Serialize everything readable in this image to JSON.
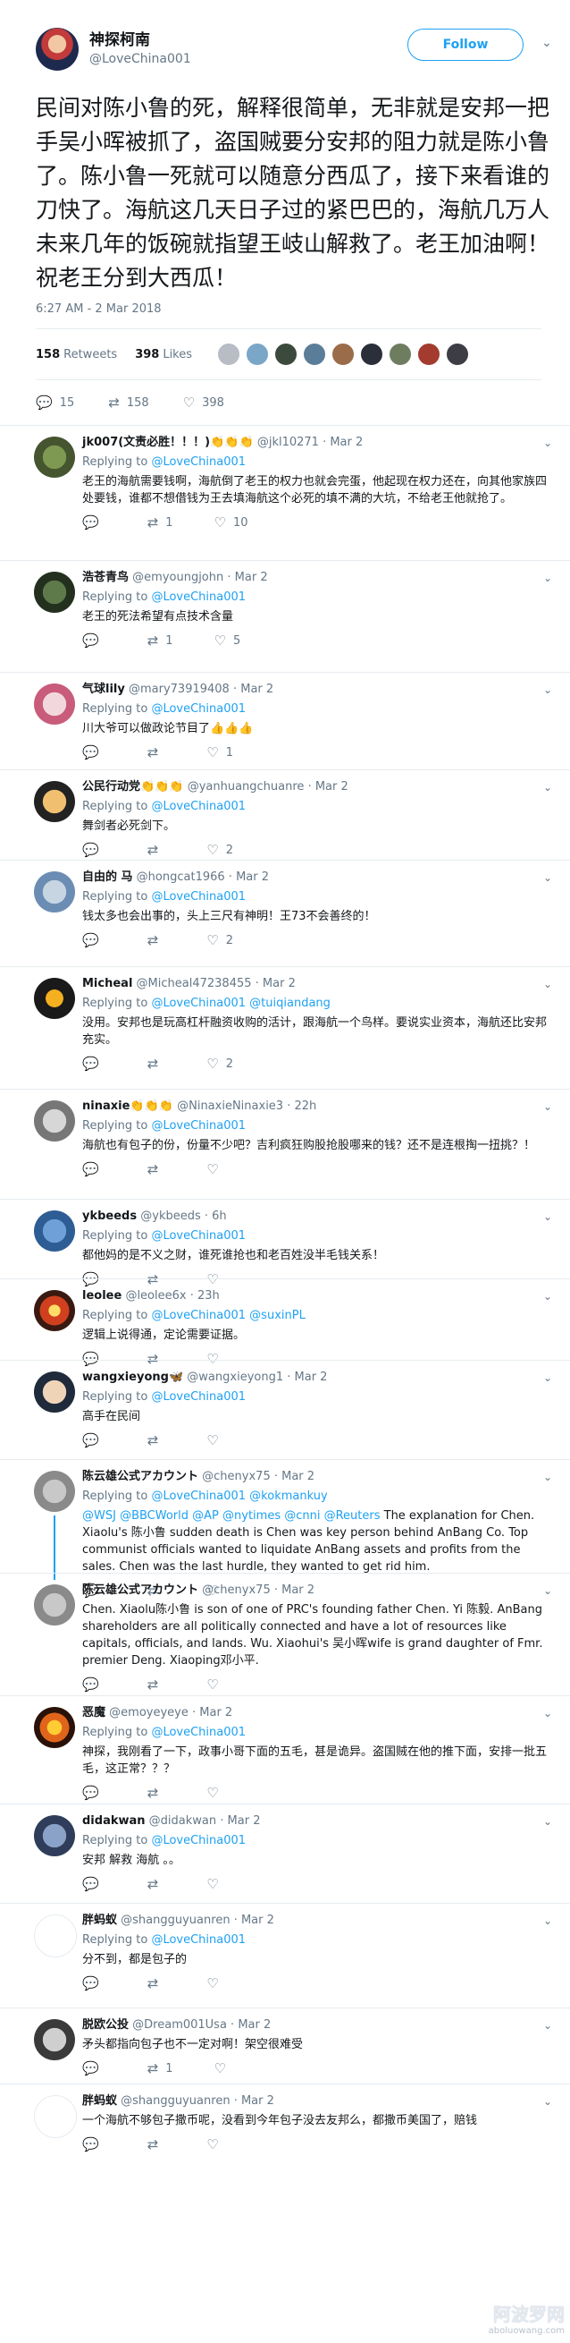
{
  "main_tweet": {
    "name": "神探柯南",
    "handle": "@LoveChina001",
    "follow_label": "Follow",
    "text": "民间对陈小鲁的死，解释很简单，无非就是安邦一把手吴小晖被抓了，盗国贼要分安邦的阻力就是陈小鲁了。陈小鲁一死就可以随意分西瓜了，接下来看谁的刀快了。海航这几天日子过的紧巴巴的，海航几万人未来几年的饭碗就指望王岐山解救了。老王加油啊！祝老王分到大西瓜！",
    "timestamp": "6:27 AM - 2 Mar 2018",
    "retweets_count": "158",
    "retweets_label": "Retweets",
    "likes_count": "398",
    "likes_label": "Likes",
    "reply_count": "15",
    "retweet_count": "158",
    "like_count": "398"
  },
  "replies": [
    {
      "name": "jk007(文责必胜！！！)👏👏👏",
      "handle": "@jkl10271",
      "time": "Mar 2",
      "replying_to": "Replying to",
      "to": "@LoveChina001",
      "text": "老王的海航需要钱啊，海航倒了老王的权力也就会完蛋，他起现在权力还在，向其他家族四处要钱，谁都不想借钱为王去填海航这个必死的填不满的大坑，不给老王他就抢了。",
      "actions": {
        "reply": "",
        "retweet": "1",
        "like": "10"
      }
    },
    {
      "name": "浩苍青鸟",
      "handle": "@emyoungjohn",
      "time": "Mar 2",
      "replying_to": "Replying to",
      "to": "@LoveChina001",
      "text": "老王的死法希望有点技术含量",
      "actions": {
        "reply": "",
        "retweet": "1",
        "like": "5"
      }
    },
    {
      "name": "气球lily",
      "handle": "@mary73919408",
      "time": "Mar 2",
      "replying_to": "Replying to",
      "to": "@LoveChina001",
      "text": "川大爷可以做政论节目了👍👍👍",
      "actions": {
        "reply": "",
        "retweet": "",
        "like": "1"
      }
    },
    {
      "name": "公民行动党👏👏👏",
      "handle": "@yanhuangchuanre",
      "time": "Mar 2",
      "replying_to": "Replying to",
      "to": "@LoveChina001",
      "text": "舞剑者必死剑下。",
      "actions": {
        "reply": "",
        "retweet": "",
        "like": "2"
      }
    },
    {
      "name": "自由的 马",
      "handle": "@hongcat1966",
      "time": "Mar 2",
      "replying_to": "Replying to",
      "to": "@LoveChina001",
      "text": "钱太多也会出事的，头上三尺有神明！王73不会善终的！",
      "actions": {
        "reply": "",
        "retweet": "",
        "like": "2"
      }
    },
    {
      "name": "Micheal",
      "handle": "@Micheal47238455",
      "time": "Mar 2",
      "replying_to": "Replying to",
      "to": "@LoveChina001 @tuiqiandang",
      "text": "没用。安邦也是玩高杠杆融资收购的活计，跟海航一个鸟样。要说实业资本，海航还比安邦充实。",
      "actions": {
        "reply": "",
        "retweet": "",
        "like": "2"
      }
    },
    {
      "name": "ninaxie👏👏👏",
      "handle": "@NinaxieNinaxie3",
      "time": "22h",
      "replying_to": "Replying to",
      "to": "@LoveChina001",
      "text": "海航也有包子的份，份量不少吧？吉利疯狂购股抢股哪来的钱？还不是连根掏一扭挑？！",
      "actions": {
        "reply": "",
        "retweet": "",
        "like": ""
      }
    },
    {
      "name": "ykbeeds",
      "handle": "@ykbeeds",
      "time": "6h",
      "replying_to": "Replying to",
      "to": "@LoveChina001",
      "text": "都他妈的是不义之财，谁死谁抢也和老百姓没半毛钱关系！",
      "actions": {
        "reply": "",
        "retweet": "",
        "like": ""
      }
    },
    {
      "name": "leolee",
      "handle": "@leolee6x",
      "time": "23h",
      "replying_to": "Replying to",
      "to": "@LoveChina001 @suxinPL",
      "text": "逻辑上说得通，定论需要证据。",
      "actions": {
        "reply": "",
        "retweet": "",
        "like": ""
      }
    },
    {
      "name": "wangxieyong🦋",
      "handle": "@wangxieyong1",
      "time": "Mar 2",
      "replying_to": "Replying to",
      "to": "@LoveChina001",
      "text": "高手在民间",
      "actions": {
        "reply": "",
        "retweet": "",
        "like": ""
      }
    },
    {
      "name": "陈云雄公式アカウント",
      "handle": "@chenyx75",
      "time": "Mar 2",
      "replying_to": "Replying to",
      "to": "@LoveChina001 @kokmankuy",
      "text": "@WSJ @BBCWorld @AP @nytimes @cnni @Reuters The explanation for Chen. Xiaolu's 陈小鲁 sudden death is Chen was key person behind AnBang Co. Top communist officials wanted to liquidate AnBang assets and profits from the sales. Chen was the last hurdle, they wanted to get rid him.",
      "actions": {
        "reply": "",
        "retweet": "",
        "like": ""
      }
    },
    {
      "name": "陈云雄公式アカウント",
      "handle": "@chenyx75",
      "time": "Mar 2",
      "replying_to": "",
      "to": "",
      "text": "Chen. Xiaolu陈小鲁 is son of one of PRC's founding father Chen. Yi 陈毅. AnBang shareholders are all politically connected and have a lot of resources like capitals, officials, and lands. Wu. Xiaohui's 吴小晖wife is grand daughter of Fmr. premier Deng. Xiaoping邓小平.",
      "actions": {
        "reply": "",
        "retweet": "",
        "like": ""
      }
    },
    {
      "name": "恶魔",
      "handle": "@emoyeyeye",
      "time": "Mar 2",
      "replying_to": "Replying to",
      "to": "@LoveChina001",
      "text": "神探，我刚看了一下，政事小哥下面的五毛，甚是诡异。盗国贼在他的推下面，安排一批五毛，这正常？？？",
      "actions": {
        "reply": "",
        "retweet": "",
        "like": ""
      }
    },
    {
      "name": "didakwan",
      "handle": "@didakwan",
      "time": "Mar 2",
      "replying_to": "Replying to",
      "to": "@LoveChina001",
      "text": "安邦 解救 海航 。。",
      "actions": {
        "reply": "",
        "retweet": "",
        "like": ""
      }
    },
    {
      "name": "胖蚂蚁",
      "handle": "@shangguyuanren",
      "time": "Mar 2",
      "replying_to": "Replying to",
      "to": "@LoveChina001",
      "text": "分不到，都是包子的",
      "actions": {
        "reply": "",
        "retweet": "",
        "like": ""
      }
    },
    {
      "name": "脱欧公投",
      "handle": "@Dream001Usa",
      "time": "Mar 2",
      "replying_to": "",
      "to": "",
      "text": "矛头都指向包子也不一定对啊！架空很难受",
      "actions": {
        "reply": "",
        "retweet": "1",
        "like": ""
      }
    },
    {
      "name": "胖蚂蚁",
      "handle": "@shangguyuanren",
      "time": "Mar 2",
      "replying_to": "",
      "to": "",
      "text": "一个海航不够包子撒币呢，没看到今年包子没去友邦么，都撒币美国了，赔钱",
      "actions": {
        "reply": "",
        "retweet": "",
        "like": ""
      }
    }
  ],
  "watermark": {
    "big": "阿波罗网",
    "small": "aboluowang.com"
  },
  "colors": {
    "accent": "#1da1f2",
    "muted": "#657786",
    "text": "#14171a",
    "divider": "#e6ecf0"
  },
  "icons": {
    "reply": "reply-icon",
    "retweet": "retweet-icon",
    "like": "heart-icon",
    "more": "chevron-down-icon"
  }
}
